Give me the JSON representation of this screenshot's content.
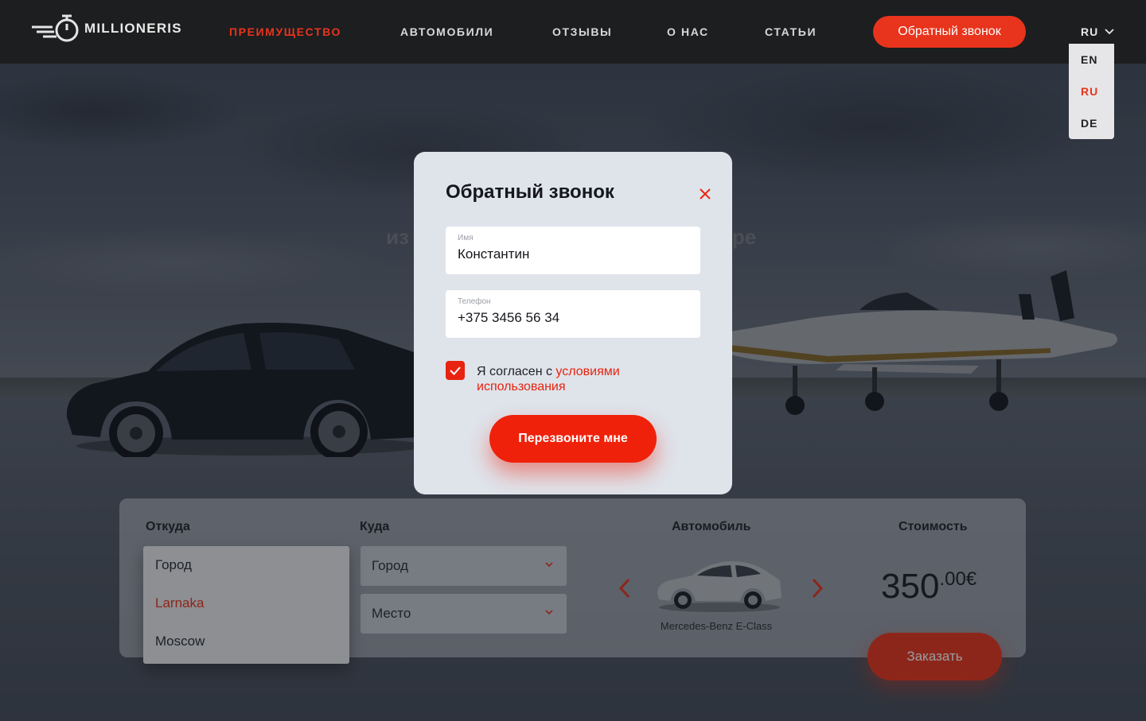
{
  "header": {
    "logo_text": "MILLIONERIS",
    "nav": [
      {
        "label": "ПРЕИМУЩЕСТВО",
        "active": true
      },
      {
        "label": "АВТОМОБИЛИ",
        "active": false
      },
      {
        "label": "ОТЗЫВЫ",
        "active": false
      },
      {
        "label": "О НАС",
        "active": false
      },
      {
        "label": "СТАТЬИ",
        "active": false
      }
    ],
    "callback_label": "Обратный звонок",
    "language": {
      "current": "RU",
      "options": [
        "EN",
        "RU",
        "DE"
      ]
    }
  },
  "hero": {
    "title_fragment_left": "из",
    "title_fragment_right": "ре"
  },
  "booking": {
    "from_label": "Откуда",
    "to_label": "Куда",
    "car_label": "Автомобиль",
    "cost_label": "Стоимость",
    "from_dropdown": {
      "options": [
        "Город",
        "Larnaka",
        "Moscow"
      ],
      "selected": "Larnaka"
    },
    "to_city_placeholder": "Город",
    "to_place_placeholder": "Место",
    "car_name": "Mercedes-Benz E-Class",
    "price_main": "350",
    "price_fraction": ".00€",
    "order_label": "Заказать"
  },
  "modal": {
    "title": "Обратный звонок",
    "name_label": "Имя",
    "name_value": "Константин",
    "phone_label": "Телефон",
    "phone_value": "+375 3456 56 34",
    "consent_text": "Я согласен с ",
    "consent_link": "условиями использования",
    "consent_checked": true,
    "submit_label": "Перезвоните мне"
  },
  "colors": {
    "accent": "#e8341c",
    "header_bg": "#1d1e20",
    "modal_bg": "#dfe3ea"
  }
}
